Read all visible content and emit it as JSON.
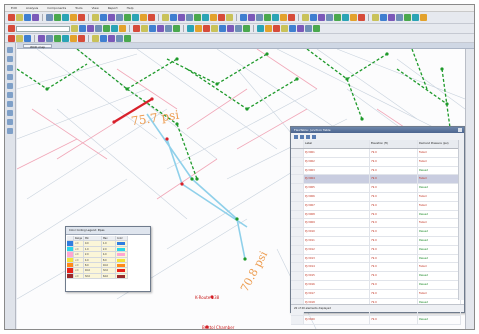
{
  "menubar": {
    "items": [
      "Edit",
      "Analysis",
      "Components",
      "Tools",
      "View",
      "Report",
      "Help"
    ]
  },
  "map_window": {
    "tab_label": "WCD map"
  },
  "map_labels": {
    "pipe_big_1": "75.7 psi",
    "pipe_big_2": "70.8 psi",
    "node_label_1": "K-Route 138",
    "node_label_2": "Bristol Chamber"
  },
  "table_window": {
    "title": "FlexTable: Junction Table",
    "columns": [
      "Label",
      "Elevation (ft)",
      "Demand Pressure (psi)"
    ],
    "rows": [
      {
        "id": "",
        "label": "PJ-3001",
        "elevation": "79.0",
        "pressure": "Failed"
      },
      {
        "id": "",
        "label": "PJ-3002",
        "elevation": "79.0",
        "pressure": "Failed"
      },
      {
        "id": "",
        "label": "PJ-3003",
        "elevation": "79.0",
        "pressure": "Passed"
      },
      {
        "id": "",
        "label": "PJ-3004",
        "elevation": "79.0",
        "pressure": "Failed"
      },
      {
        "id": "",
        "label": "PJ-3005",
        "elevation": "79.0",
        "pressure": "Passed"
      },
      {
        "id": "",
        "label": "PJ-3006",
        "elevation": "79.0",
        "pressure": "Failed"
      },
      {
        "id": "",
        "label": "PJ-3007",
        "elevation": "79.0",
        "pressure": "Failed"
      },
      {
        "id": "",
        "label": "PJ-3008",
        "elevation": "79.0",
        "pressure": "Passed"
      },
      {
        "id": "",
        "label": "PJ-3009",
        "elevation": "79.0",
        "pressure": "Failed"
      },
      {
        "id": "",
        "label": "PJ-3010",
        "elevation": "79.0",
        "pressure": "Passed"
      },
      {
        "id": "",
        "label": "PJ-3011",
        "elevation": "79.0",
        "pressure": "Passed"
      },
      {
        "id": "",
        "label": "PJ-3012",
        "elevation": "79.0",
        "pressure": "Passed"
      },
      {
        "id": "",
        "label": "PJ-3013",
        "elevation": "79.0",
        "pressure": "Passed"
      },
      {
        "id": "",
        "label": "PJ-3014",
        "elevation": "79.0",
        "pressure": "Failed"
      },
      {
        "id": "",
        "label": "PJ-3015",
        "elevation": "79.0",
        "pressure": "Passed"
      },
      {
        "id": "",
        "label": "PJ-3016",
        "elevation": "79.0",
        "pressure": "Passed"
      },
      {
        "id": "",
        "label": "PJ-3017",
        "elevation": "79.0",
        "pressure": "Failed"
      },
      {
        "id": "",
        "label": "PJ-3018",
        "elevation": "79.0",
        "pressure": "Passed"
      },
      {
        "id": "",
        "label": "PJ-3019",
        "elevation": "79.0",
        "pressure": "Passed"
      },
      {
        "id": "",
        "label": "PJ-3020",
        "elevation": "79.0",
        "pressure": "Passed"
      }
    ],
    "selected_row_index": 3,
    "status": "20 of 20 elements displayed"
  },
  "legend_window": {
    "title": "Color Coding Legend: Pipes",
    "columns": [
      "",
      "Range",
      "Min",
      "Max",
      "Color"
    ],
    "rows": [
      {
        "range": "<=",
        "min": "0.0",
        "max": "1.0",
        "color": "#2f7de0"
      },
      {
        "range": "<=",
        "min": "1.0",
        "max": "2.0",
        "color": "#29d6e8"
      },
      {
        "range": "<=",
        "min": "2.0",
        "max": "4.0",
        "color": "#ffa7d2"
      },
      {
        "range": "<=",
        "min": "4.0",
        "max": "8.0",
        "color": "#f3e23a"
      },
      {
        "range": "<=",
        "min": "8.0",
        "max": "16.0",
        "color": "#ff8a1a"
      },
      {
        "range": "<=",
        "min": "16.0",
        "max": "32.0",
        "color": "#e8221b"
      },
      {
        "range": "<=",
        "min": "32.0",
        "max": "64.0",
        "color": "#9a2a2a"
      }
    ]
  },
  "colors": {
    "pipe_green": "#1e9a2a",
    "pipe_blue": "#8fd0ea",
    "pipe_red": "#d8202a",
    "pipe_pink": "#f1a7b8",
    "pipe_gray": "#c9d3de",
    "label_orange": "#e98c32"
  }
}
